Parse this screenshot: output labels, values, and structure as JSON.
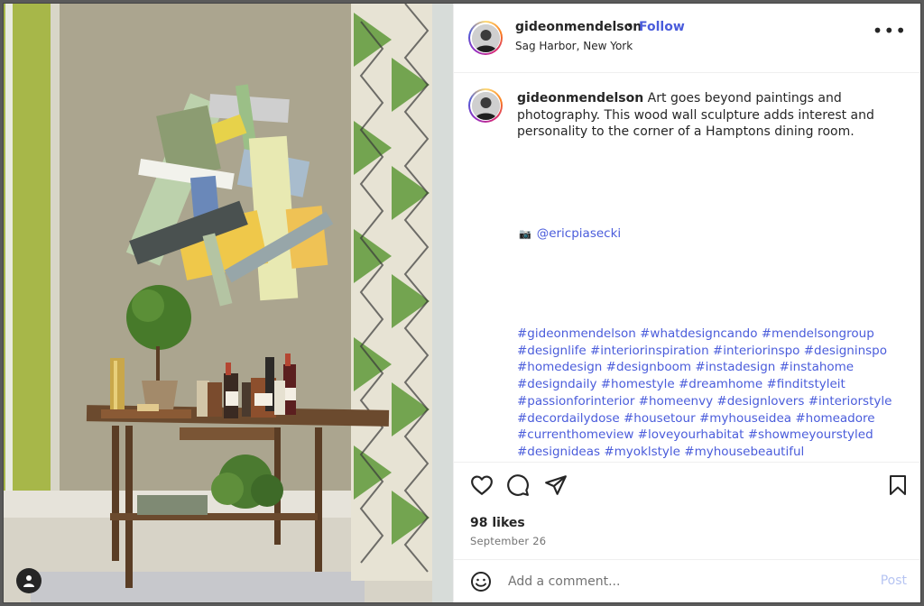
{
  "post": {
    "username": "gideonmendelson",
    "separator": "•",
    "follow_label": "Follow",
    "location": "Sag Harbor, New York",
    "more_label": "•••",
    "caption": "Art goes beyond paintings and photography. This wood wall sculpture adds interest and personality to the corner of a Hamptons dining room.",
    "credit_icon": "camera-icon",
    "credit_handle": "@ericpiasecki",
    "hashtags": [
      "#gideonmendelson",
      "#whatdesigncando",
      "#mendelsongroup",
      "#designlife",
      "#interiorinspiration",
      "#interiorinspo",
      "#designinspo",
      "#homedesign",
      "#designboom",
      "#instadesign",
      "#instahome",
      "#designdaily",
      "#homestyle",
      "#dreamhome",
      "#finditstyleit",
      "#passionforinterior",
      "#homeenvy",
      "#designlovers",
      "#interiorstyle",
      "#decordailydose",
      "#housetour",
      "#myhouseidea",
      "#homeadore",
      "#currenthomeview",
      "#loveyourhabitat",
      "#showmeyourstyled",
      "#designideas",
      "#myoklstyle",
      "#myhousebeautiful"
    ],
    "likes": "98 likes",
    "date": "September 26"
  },
  "comment": {
    "placeholder": "Add a comment...",
    "post_label": "Post"
  },
  "colors": {
    "link_blue": "#4a5cdb",
    "text": "#262626",
    "muted": "#737373",
    "post_disabled": "#b6c4f2"
  },
  "icons": [
    "heart-icon",
    "comment-icon",
    "share-icon",
    "bookmark-icon",
    "emoji-icon",
    "more-icon",
    "user-tag-icon"
  ]
}
